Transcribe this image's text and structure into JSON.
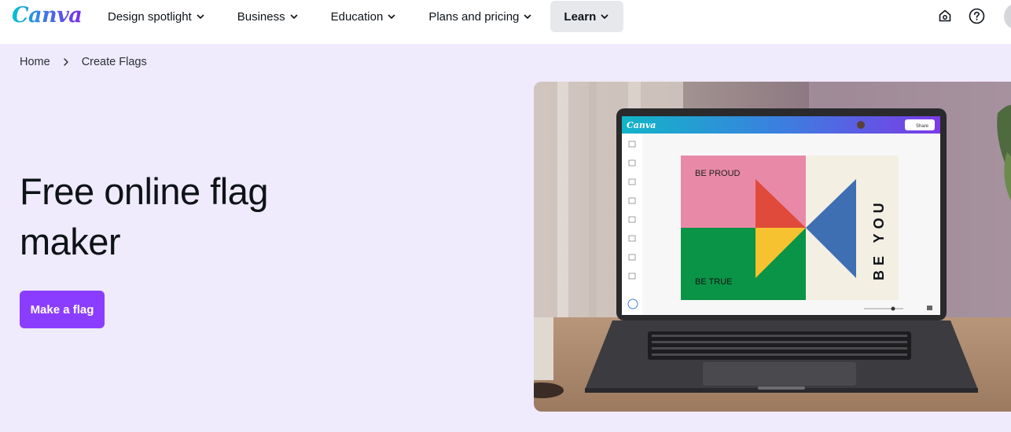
{
  "header": {
    "logo_text": "Canva",
    "nav": [
      {
        "label": "Design spotlight",
        "has_dropdown": true
      },
      {
        "label": "Business",
        "has_dropdown": true
      },
      {
        "label": "Education",
        "has_dropdown": true
      },
      {
        "label": "Plans and pricing",
        "has_dropdown": true
      },
      {
        "label": "Learn",
        "has_dropdown": true,
        "active": true
      }
    ],
    "icons": [
      "home-icon",
      "help-icon",
      "avatar"
    ]
  },
  "breadcrumb": {
    "home": "Home",
    "current": "Create Flags"
  },
  "hero": {
    "title_line1": "Free online flag",
    "title_line2": "maker",
    "cta_label": "Make a flag"
  },
  "hero_image": {
    "app_logo": "Canva",
    "share_label": "Share",
    "flag_texts": {
      "top_left": "BE PROUD",
      "bottom_left": "BE TRUE",
      "vertical": "BE YOU"
    }
  },
  "colors": {
    "brand_purple": "#8b3dff",
    "page_background": "#efeafc",
    "flag_pink": "#e889a8",
    "flag_red": "#e04a3a",
    "flag_yellow": "#f7c22f",
    "flag_green": "#0a9447",
    "flag_blue": "#3f6fb3",
    "flag_cream": "#f4efe3"
  }
}
